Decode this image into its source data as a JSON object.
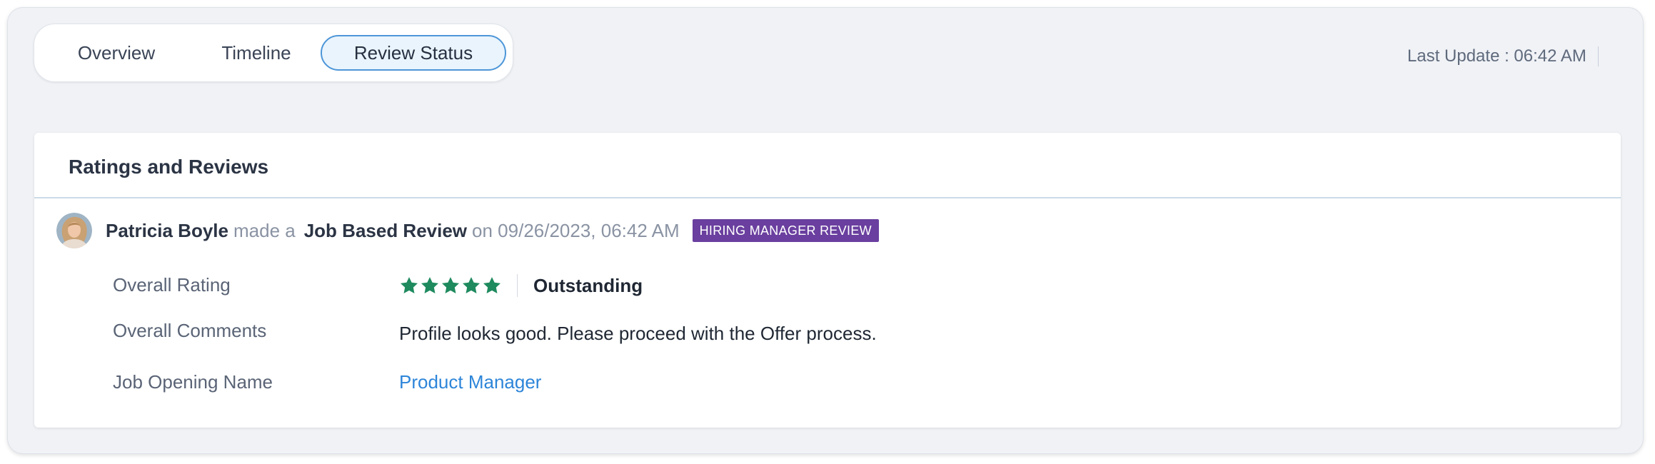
{
  "tabs": [
    {
      "label": "Overview"
    },
    {
      "label": "Timeline"
    },
    {
      "label": "Review Status",
      "active": true
    }
  ],
  "last_update": "Last Update : 06:42 AM",
  "card": {
    "title": "Ratings and Reviews",
    "review": {
      "reviewer": "Patricia Boyle",
      "made_a": "made a",
      "review_type": "Job Based Review",
      "date_text": "on 09/26/2023, 06:42 AM",
      "badge": "HIRING MANAGER REVIEW",
      "fields": {
        "overall_rating_label": "Overall Rating",
        "rating_stars": 5,
        "rating_max": 5,
        "rating_text": "Outstanding",
        "overall_comments_label": "Overall Comments",
        "overall_comments": "Profile looks good. Please proceed with the Offer process.",
        "job_opening_label": "Job Opening Name",
        "job_opening": "Product Manager"
      }
    }
  },
  "colors": {
    "accent": "#4d96d8",
    "star": "#1e8a5e",
    "badge_bg": "#6a3f9f",
    "link": "#2d85d9",
    "page_bg": "#f0f2f6"
  },
  "icons": {
    "star": "star-icon",
    "avatar": "avatar"
  }
}
